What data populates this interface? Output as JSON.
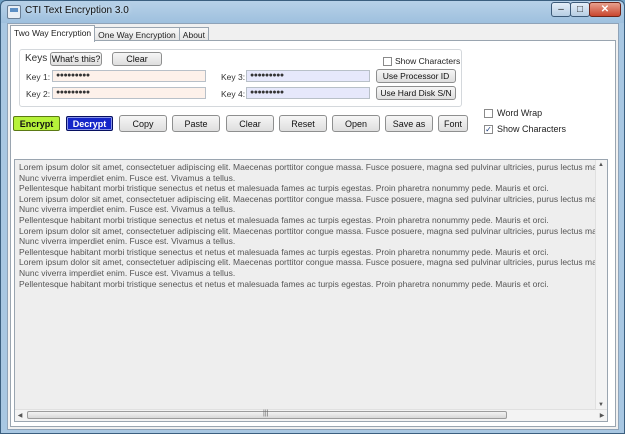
{
  "window": {
    "title": "CTI Text Encryption 3.0",
    "min_icon": "minimize-icon",
    "max_icon": "maximize-icon",
    "close_icon": "close-icon",
    "min_glyph": "–",
    "max_glyph": "□",
    "close_glyph": "✕"
  },
  "tabs": [
    {
      "label": "Two Way Encryption",
      "active": true
    },
    {
      "label": "One Way Encryption",
      "active": false
    },
    {
      "label": "About",
      "active": false
    }
  ],
  "keys": {
    "title": "Keys",
    "whats_this_label": "What's this?",
    "clear_label": "Clear",
    "show_characters_label": "Show Characters",
    "show_characters_checked": false,
    "key1_label": "Key 1:",
    "key1_value": "●●●●●●●●●",
    "key2_label": "Key 2:",
    "key2_value": "●●●●●●●●●",
    "key3_label": "Key 3:",
    "key3_value": "●●●●●●●●●",
    "key4_label": "Key 4:",
    "key4_value": "●●●●●●●●●",
    "use_processor_label": "Use Processor ID",
    "use_hdd_label": "Use Hard Disk S/N"
  },
  "options": {
    "word_wrap_label": "Word Wrap",
    "word_wrap_checked": false,
    "show_characters_label": "Show Characters",
    "show_characters_checked": true,
    "check_glyph": "✓"
  },
  "toolbar": {
    "encrypt_label": "Encrypt",
    "decrypt_label": "Decrypt",
    "copy_label": "Copy",
    "paste_label": "Paste",
    "clear_label": "Clear",
    "reset_label": "Reset",
    "open_label": "Open",
    "save_as_label": "Save as",
    "font_label": "Font"
  },
  "text_area": {
    "lines": [
      "Lorem ipsum dolor sit amet, consectetuer adipiscing elit. Maecenas porttitor congue massa. Fusce posuere, magna sed pulvinar ultricies, purus lectus malesuada libero, sit amet commodo magna eros quis urna.",
      "Nunc viverra imperdiet enim. Fusce est. Vivamus a tellus.",
      "Pellentesque habitant morbi tristique senectus et netus et malesuada fames ac turpis egestas. Proin pharetra nonummy pede. Mauris et orci.",
      "Lorem ipsum dolor sit amet, consectetuer adipiscing elit. Maecenas porttitor congue massa. Fusce posuere, magna sed pulvinar ultricies, purus lectus malesuada libero, sit amet commodo magna eros quis urna.",
      "Nunc viverra imperdiet enim. Fusce est. Vivamus a tellus.",
      "Pellentesque habitant morbi tristique senectus et netus et malesuada fames ac turpis egestas. Proin pharetra nonummy pede. Mauris et orci.",
      "Lorem ipsum dolor sit amet, consectetuer adipiscing elit. Maecenas porttitor congue massa. Fusce posuere, magna sed pulvinar ultricies, purus lectus malesuada libero, sit amet commodo magna eros quis urna.",
      "Nunc viverra imperdiet enim. Fusce est. Vivamus a tellus.",
      "Pellentesque habitant morbi tristique senectus et netus et malesuada fames ac turpis egestas. Proin pharetra nonummy pede. Mauris et orci.",
      "Lorem ipsum dolor sit amet, consectetuer adipiscing elit. Maecenas porttitor congue massa. Fusce posuere, magna sed pulvinar ultricies, purus lectus malesuada libero, sit amet commodo magna eros quis urna.",
      "Nunc viverra imperdiet enim. Fusce est. Vivamus a tellus.",
      "Pellentesque habitant morbi tristique senectus et netus et malesuada fames ac turpis egestas. Proin pharetra nonummy pede. Mauris et orci."
    ],
    "scroll_up_glyph": "▲",
    "scroll_down_glyph": "▼",
    "scroll_left_glyph": "◀",
    "scroll_right_glyph": "▶",
    "grip_glyph": "|||"
  },
  "colors": {
    "encrypt_bg": "#b6f23a",
    "decrypt_bg": "#1526c8",
    "key_left_bg": "#fdf1ea",
    "key_right_bg": "#e6e8fb",
    "text_area_bg": "#eeeeee"
  }
}
